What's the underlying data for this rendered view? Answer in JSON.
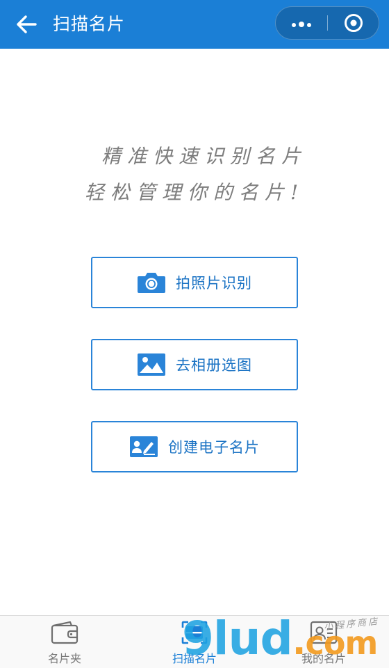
{
  "header": {
    "title": "扫描名片",
    "back_icon": "arrow-left-icon",
    "more_icon": "more-dots-icon",
    "close_icon": "target-circle-icon",
    "color": "#1b7fd6"
  },
  "slogan": {
    "line1": "精准快速识别名片",
    "line2": "轻松管理你的名片!"
  },
  "actions": [
    {
      "label": "拍照片识别",
      "icon": "camera-icon"
    },
    {
      "label": "去相册选图",
      "icon": "image-icon"
    },
    {
      "label": "创建电子名片",
      "icon": "id-card-pen-icon"
    }
  ],
  "tabbar": {
    "active_index": 1,
    "active_color": "#1b7fd6",
    "items": [
      {
        "label": "名片夹",
        "icon": "wallet-icon"
      },
      {
        "label": "扫描名片",
        "icon": "scan-frame-icon"
      },
      {
        "label": "我的名片",
        "icon": "contact-card-icon"
      }
    ]
  },
  "watermark": {
    "digits": "9lud",
    "dot": ".",
    "suffix": "com",
    "store_text": "小程序商店"
  }
}
